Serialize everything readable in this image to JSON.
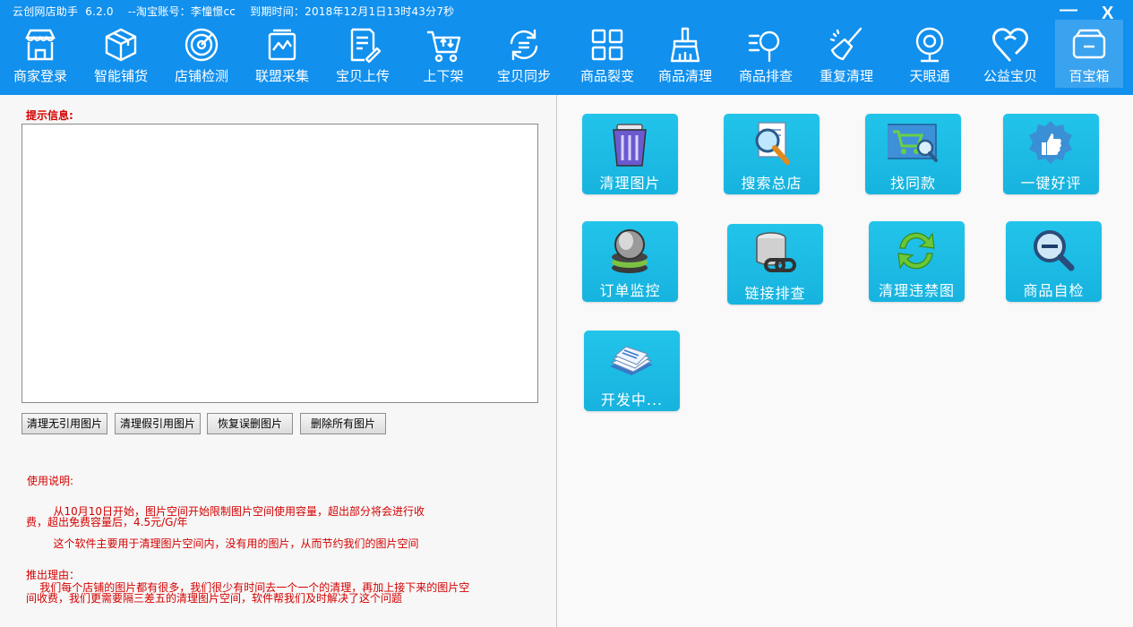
{
  "app": {
    "title": "云创网店助手  6.2.0    --淘宝账号：李憧憬cc    到期时间：2018年12月1日13时43分7秒",
    "minimize": "—",
    "close": "X"
  },
  "nav": [
    {
      "label": "商家登录",
      "icon": "shop-icon"
    },
    {
      "label": "智能铺货",
      "icon": "box-icon"
    },
    {
      "label": "店铺检测",
      "icon": "radar-icon"
    },
    {
      "label": "联盟采集",
      "icon": "collect-icon"
    },
    {
      "label": "宝贝上传",
      "icon": "upload-doc-icon"
    },
    {
      "label": "上下架",
      "icon": "cart-icon"
    },
    {
      "label": "宝贝同步",
      "icon": "sync-icon"
    },
    {
      "label": "商品裂变",
      "icon": "grid-icon"
    },
    {
      "label": "商品清理",
      "icon": "broom-icon"
    },
    {
      "label": "商品排查",
      "icon": "search-icon"
    },
    {
      "label": "重复清理",
      "icon": "sweep-icon"
    },
    {
      "label": "天眼通",
      "icon": "camera-icon"
    },
    {
      "label": "公益宝贝",
      "icon": "heart-icon"
    },
    {
      "label": "百宝箱",
      "icon": "wallet-icon",
      "active": true
    }
  ],
  "left": {
    "hint_label": "提示信息:",
    "log_text": "",
    "buttons": [
      "清理无引用图片",
      "清理假引用图片",
      "恢复误删图片",
      "删除所有图片"
    ],
    "usage_title": "使用说明:",
    "para1_line1": "        从10月10日开始，图片空间开始限制图片空间使用容量，超出部分将会进行收",
    "para1_line2": "费，超出免费容量后，4.5元/G/年",
    "para2": "        这个软件主要用于清理图片空间内，没有用的图片，从而节约我们的图片空间",
    "reason_title": "推出理由：",
    "reason_line1": "    我们每个店铺的图片都有很多，我们很少有时间去一个一个的清理，再加上接下来的图片空",
    "reason_line2": "间收费，我们更需要隔三差五的清理图片空间，软件帮我们及时解决了这个问题"
  },
  "tools": [
    {
      "label": "清理图片",
      "icon": "trash-icon"
    },
    {
      "label": "搜索总店",
      "icon": "doc-search-icon"
    },
    {
      "label": "找同款",
      "icon": "cart-search-icon"
    },
    {
      "label": "一键好评",
      "icon": "thumbs-up-icon"
    },
    {
      "label": "订单监控",
      "icon": "monitor-icon"
    },
    {
      "label": "链接排查",
      "icon": "link-db-icon"
    },
    {
      "label": "清理违禁图",
      "icon": "refresh-icon"
    },
    {
      "label": "商品自检",
      "icon": "zoom-out-icon"
    },
    {
      "label": "开发中...",
      "icon": "documents-icon"
    }
  ],
  "colors": {
    "topbar": "#1190ee",
    "tile": "#1cbbe6",
    "hint_text": "#d40000"
  }
}
